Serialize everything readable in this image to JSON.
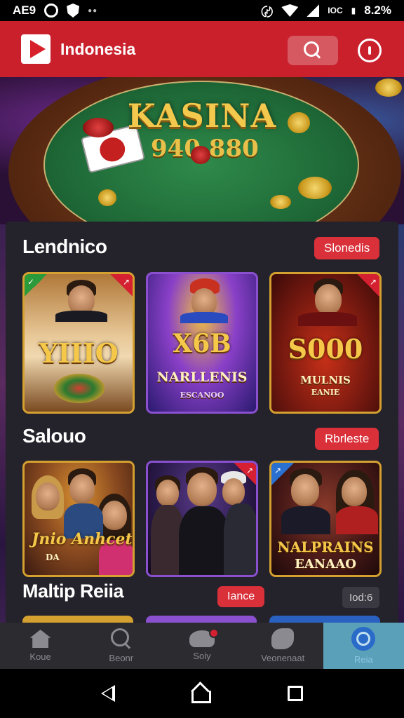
{
  "status_bar": {
    "left_text": "AE9",
    "sim_text": "IOC",
    "battery": "8.2%"
  },
  "header": {
    "title": "Indonesia"
  },
  "hero": {
    "title": "KASINA",
    "subtitle": "940 880"
  },
  "sections": [
    {
      "title": "Lendnico",
      "pill": "Slonedis",
      "cards": [
        {
          "title": "YIIIO",
          "sub": ""
        },
        {
          "title": "X6B",
          "sub": "NARLLENIS",
          "tag": "ESCANOO"
        },
        {
          "title": "S000",
          "sub": "MULNIS",
          "tag": "EANIE"
        }
      ]
    },
    {
      "title": "Salouo",
      "pill": "Rbrleste",
      "cards": [
        {
          "title": "Jnio Anhcet",
          "sub": "DA"
        },
        {
          "title": "",
          "sub": ""
        },
        {
          "title": "NALPRAINS",
          "sub": "EANAAO"
        }
      ]
    },
    {
      "title": "Maltip Reiia",
      "pill": "Iance",
      "count": "Iod:6"
    }
  ],
  "bottom_nav": [
    {
      "label": "Koue",
      "icon": "home-icon"
    },
    {
      "label": "Beonr",
      "icon": "search-icon"
    },
    {
      "label": "Soiy",
      "icon": "bag-icon"
    },
    {
      "label": "Veonenaat",
      "icon": "leaf-icon"
    },
    {
      "label": "Reia",
      "icon": "profile-icon"
    }
  ],
  "colors": {
    "brand": "#c9202c",
    "panel": "#24222a",
    "nav_active": "#5aa0b8",
    "accent_gold": "#f2c94c"
  }
}
